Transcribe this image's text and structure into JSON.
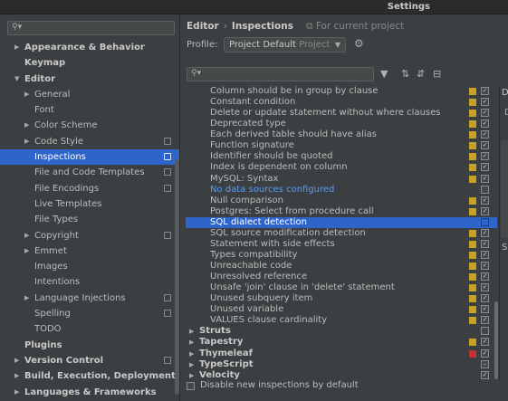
{
  "window": {
    "title": "Settings"
  },
  "sidebar": {
    "search_placeholder": "",
    "items": [
      {
        "label": "Appearance & Behavior",
        "level": 0,
        "arrow": "▶",
        "bold": true,
        "project": false
      },
      {
        "label": "Keymap",
        "level": 0,
        "arrow": "",
        "bold": true,
        "project": false
      },
      {
        "label": "Editor",
        "level": 0,
        "arrow": "▼",
        "bold": true,
        "project": false
      },
      {
        "label": "General",
        "level": 1,
        "arrow": "▶",
        "bold": false,
        "project": false
      },
      {
        "label": "Font",
        "level": 1,
        "arrow": "",
        "bold": false,
        "project": false
      },
      {
        "label": "Color Scheme",
        "level": 1,
        "arrow": "▶",
        "bold": false,
        "project": false
      },
      {
        "label": "Code Style",
        "level": 1,
        "arrow": "▶",
        "bold": false,
        "project": true
      },
      {
        "label": "Inspections",
        "level": 1,
        "arrow": "",
        "bold": false,
        "project": true,
        "selected": true
      },
      {
        "label": "File and Code Templates",
        "level": 1,
        "arrow": "",
        "bold": false,
        "project": true
      },
      {
        "label": "File Encodings",
        "level": 1,
        "arrow": "",
        "bold": false,
        "project": true
      },
      {
        "label": "Live Templates",
        "level": 1,
        "arrow": "",
        "bold": false,
        "project": false
      },
      {
        "label": "File Types",
        "level": 1,
        "arrow": "",
        "bold": false,
        "project": false
      },
      {
        "label": "Copyright",
        "level": 1,
        "arrow": "▶",
        "bold": false,
        "project": true
      },
      {
        "label": "Emmet",
        "level": 1,
        "arrow": "▶",
        "bold": false,
        "project": false
      },
      {
        "label": "Images",
        "level": 1,
        "arrow": "",
        "bold": false,
        "project": false
      },
      {
        "label": "Intentions",
        "level": 1,
        "arrow": "",
        "bold": false,
        "project": false
      },
      {
        "label": "Language Injections",
        "level": 1,
        "arrow": "▶",
        "bold": false,
        "project": true
      },
      {
        "label": "Spelling",
        "level": 1,
        "arrow": "",
        "bold": false,
        "project": true
      },
      {
        "label": "TODO",
        "level": 1,
        "arrow": "",
        "bold": false,
        "project": false
      },
      {
        "label": "Plugins",
        "level": 0,
        "arrow": "",
        "bold": true,
        "project": false
      },
      {
        "label": "Version Control",
        "level": 0,
        "arrow": "▶",
        "bold": true,
        "project": true
      },
      {
        "label": "Build, Execution, Deployment",
        "level": 0,
        "arrow": "▶",
        "bold": true,
        "project": false
      },
      {
        "label": "Languages & Frameworks",
        "level": 0,
        "arrow": "▶",
        "bold": true,
        "project": false
      }
    ]
  },
  "breadcrumb": {
    "parent": "Editor",
    "separator": "›",
    "current": "Inspections",
    "note": "For current project"
  },
  "profile": {
    "label": "Profile:",
    "value": "Project Default",
    "scope": "Project"
  },
  "inspections": {
    "search_placeholder": "",
    "rows": [
      {
        "name": "Column should be in group by clause",
        "group": false,
        "severity": "#c9a028",
        "checked": true
      },
      {
        "name": "Constant condition",
        "group": false,
        "severity": "#c9a028",
        "checked": true
      },
      {
        "name": "Delete or update statement without where clauses",
        "group": false,
        "severity": "#c9a028",
        "checked": true
      },
      {
        "name": "Deprecated type",
        "group": false,
        "severity": "#c9a028",
        "checked": true
      },
      {
        "name": "Each derived table should have alias",
        "group": false,
        "severity": "#c9a028",
        "checked": true
      },
      {
        "name": "Function signature",
        "group": false,
        "severity": "#c9a028",
        "checked": true
      },
      {
        "name": "Identifier should be quoted",
        "group": false,
        "severity": "#c9a028",
        "checked": true
      },
      {
        "name": "Index is dependent on column",
        "group": false,
        "severity": "#c9a028",
        "checked": true
      },
      {
        "name": "MySQL: Syntax",
        "group": false,
        "severity": "#c9a028",
        "checked": true
      },
      {
        "name": "No data sources configured",
        "group": false,
        "severity": "",
        "checked": false,
        "blue": true
      },
      {
        "name": "Null comparison",
        "group": false,
        "severity": "#c9a028",
        "checked": true
      },
      {
        "name": "Postgres: Select from procedure call",
        "group": false,
        "severity": "#c9a028",
        "checked": true
      },
      {
        "name": "SQL dialect detection",
        "group": false,
        "severity": "",
        "checked": false,
        "selected": true
      },
      {
        "name": "SQL source modification detection",
        "group": false,
        "severity": "#c9a028",
        "checked": true
      },
      {
        "name": "Statement with side effects",
        "group": false,
        "severity": "#c9a028",
        "checked": true
      },
      {
        "name": "Types compatibility",
        "group": false,
        "severity": "#c9a028",
        "checked": true
      },
      {
        "name": "Unreachable code",
        "group": false,
        "severity": "#c9a028",
        "checked": true
      },
      {
        "name": "Unresolved reference",
        "group": false,
        "severity": "#c9a028",
        "checked": true
      },
      {
        "name": "Unsafe 'join' clause in 'delete' statement",
        "group": false,
        "severity": "#c9a028",
        "checked": true
      },
      {
        "name": "Unused subquery item",
        "group": false,
        "severity": "#c9a028",
        "checked": true
      },
      {
        "name": "Unused variable",
        "group": false,
        "severity": "#c9a028",
        "checked": true
      },
      {
        "name": "VALUES clause cardinality",
        "group": false,
        "severity": "#c9a028",
        "checked": true
      },
      {
        "name": "Struts",
        "group": true,
        "severity": "",
        "checked": false
      },
      {
        "name": "Tapestry",
        "group": true,
        "severity": "#c9a028",
        "checked": true
      },
      {
        "name": "Thymeleaf",
        "group": true,
        "severity": "#c23232",
        "checked": true
      },
      {
        "name": "TypeScript",
        "group": true,
        "severity": "",
        "checked": true,
        "partial": true
      },
      {
        "name": "Velocity",
        "group": true,
        "severity": "",
        "checked": true
      }
    ]
  },
  "bottom": {
    "disable_new_label": "Disable new inspections by default"
  },
  "right_panel": {
    "d1": "De",
    "d2": "D",
    "s": "Se"
  }
}
